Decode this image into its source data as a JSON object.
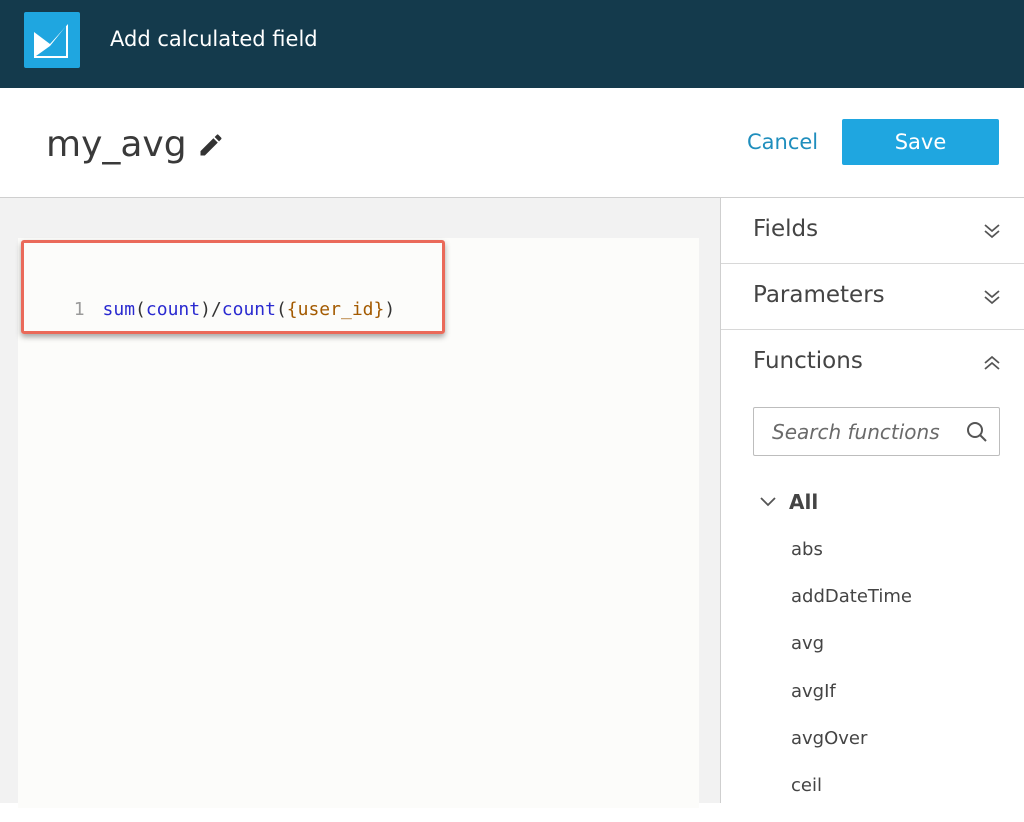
{
  "app": {
    "title": "Add calculated field"
  },
  "header": {
    "field_name": "my_avg",
    "cancel_label": "Cancel",
    "save_label": "Save"
  },
  "editor": {
    "line_number": "1",
    "tokens": {
      "t1": "sum",
      "t2": "(",
      "t3": "count",
      "t4": ")/",
      "t5": "count",
      "t6": "(",
      "t7": "{user_id}",
      "t8": ")"
    }
  },
  "sidebar": {
    "fields_label": "Fields",
    "parameters_label": "Parameters",
    "functions_label": "Functions",
    "search_placeholder": "Search functions",
    "tree_root_label": "All",
    "functions": [
      "abs",
      "addDateTime",
      "avg",
      "avgIf",
      "avgOver",
      "ceil"
    ]
  },
  "colors": {
    "topbar": "#143a4c",
    "accent": "#1fa6e0",
    "highlight": "#ea6a5a"
  },
  "icons": [
    "quicksight-logo-icon",
    "pencil-icon",
    "chevron-double-down-icon",
    "chevron-double-up-icon",
    "search-icon",
    "chevron-down-icon"
  ]
}
